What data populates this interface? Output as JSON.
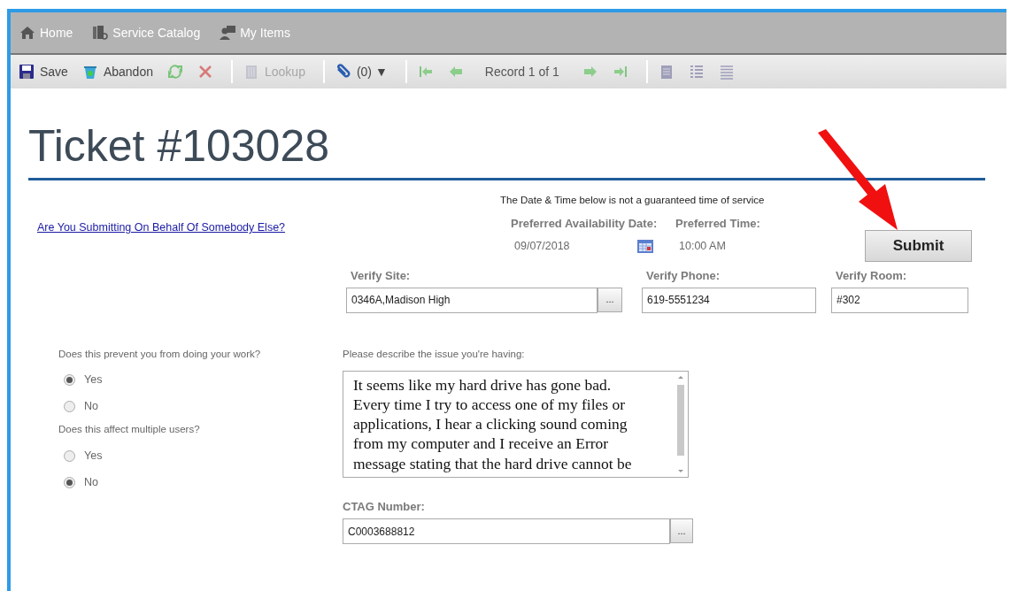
{
  "nav": [
    {
      "label": "Home"
    },
    {
      "label": "Service Catalog"
    },
    {
      "label": "My Items"
    }
  ],
  "toolbar": [
    {
      "kind": "button",
      "label": "Save",
      "disabled": false
    },
    {
      "kind": "button",
      "label": "Abandon",
      "disabled": false
    },
    {
      "kind": "button",
      "disabled": true
    },
    {
      "kind": "button",
      "disabled": true
    },
    {
      "kind": "separator"
    },
    {
      "kind": "button",
      "label": "Lookup",
      "disabled": true
    },
    {
      "kind": "separator"
    },
    {
      "kind": "button",
      "label": "(0)",
      "caret": "▼",
      "disabled": false
    },
    {
      "kind": "separator"
    },
    {
      "kind": "button",
      "disabled": true
    },
    {
      "kind": "button",
      "disabled": true
    },
    {
      "kind": "text",
      "label": "Record 1 of 1"
    },
    {
      "kind": "button",
      "disabled": true
    },
    {
      "kind": "button",
      "disabled": true
    },
    {
      "kind": "separator"
    },
    {
      "kind": "button",
      "disabled": true
    },
    {
      "kind": "button",
      "disabled": true
    },
    {
      "kind": "button",
      "disabled": true
    }
  ],
  "title": "Ticket #103028",
  "behalf_link": "Are You Submitting On Behalf Of Somebody Else?",
  "schedule": {
    "note": "The Date & Time below is not a guaranteed time of service",
    "date_label": "Preferred Availability Date:",
    "date_value": "09/07/2018",
    "time_label": "Preferred Time:",
    "time_value": "10:00 AM"
  },
  "submit_button": "Submit",
  "annotation_arrow": true,
  "verify": [
    {
      "label": "Verify Site:",
      "value": "0346A,Madison High",
      "lookup": "..."
    },
    {
      "label": "Verify Phone:",
      "value": "619-5551234"
    },
    {
      "label": "Verify Room:",
      "value": "#302"
    }
  ],
  "questions": [
    {
      "text": "Does this prevent you from doing your work?",
      "options": [
        {
          "label": "Yes",
          "selected": true
        },
        {
          "label": "No",
          "selected": false
        }
      ]
    },
    {
      "text": "Does this affect multiple users?",
      "options": [
        {
          "label": "Yes",
          "selected": false
        },
        {
          "label": "No",
          "selected": true
        }
      ]
    }
  ],
  "description": {
    "label": "Please describe the issue you're having:",
    "value": "It seems like my hard drive has gone bad. Every time I try to access one of my files or applications, I hear a clicking sound coming from my computer and I receive an Error message stating that the hard drive cannot be"
  },
  "ctag": {
    "label": "CTAG Number:",
    "value": "C0003688812",
    "lookup": "..."
  }
}
